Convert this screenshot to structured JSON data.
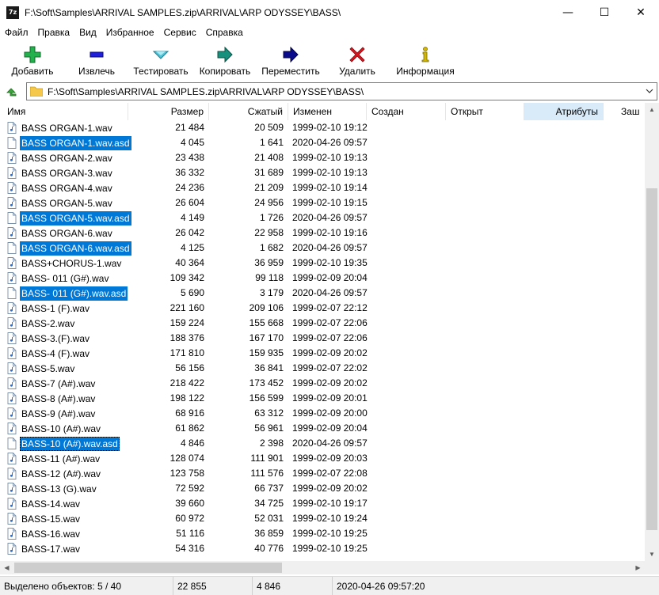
{
  "window": {
    "title": "F:\\Soft\\Samples\\ARRIVAL SAMPLES.zip\\ARRIVAL\\ARP ODYSSEY\\BASS\\",
    "app_icon": "7z",
    "controls": {
      "minimize": "—",
      "maximize": "☐",
      "close": "✕"
    }
  },
  "menu": [
    {
      "label": "Файл"
    },
    {
      "label": "Правка"
    },
    {
      "label": "Вид"
    },
    {
      "label": "Избранное"
    },
    {
      "label": "Сервис"
    },
    {
      "label": "Справка"
    }
  ],
  "toolbar": [
    {
      "label": "Добавить",
      "icon": "plus-icon",
      "color": "#22b14c"
    },
    {
      "label": "Извлечь",
      "icon": "minus-icon",
      "color": "#1f1fdc"
    },
    {
      "label": "Тестировать",
      "icon": "test-chevron-icon",
      "color": "#4fc3d8"
    },
    {
      "label": "Копировать",
      "icon": "copy-arrow-icon",
      "color": "#17907d"
    },
    {
      "label": "Переместить",
      "icon": "move-arrow-icon",
      "color": "#0a0a8c"
    },
    {
      "label": "Удалить",
      "icon": "delete-x-icon",
      "color": "#e0141e"
    },
    {
      "label": "Информация",
      "icon": "info-icon",
      "color": "#d4b800"
    }
  ],
  "address": {
    "path": "F:\\Soft\\Samples\\ARRIVAL SAMPLES.zip\\ARRIVAL\\ARP ODYSSEY\\BASS\\"
  },
  "columns": {
    "name": "Имя",
    "size": "Размер",
    "packed": "Сжатый",
    "modified": "Изменен",
    "created": "Создан",
    "accessed": "Открыт",
    "attributes": "Атрибуты",
    "encrypted": "Заш"
  },
  "files": [
    {
      "name": "BASS ORGAN-1.wav",
      "size": "21 484",
      "packed": "20 509",
      "modified": "1999-02-10 19:12",
      "selected": false
    },
    {
      "name": "BASS ORGAN-1.wav.asd",
      "size": "4 045",
      "packed": "1 641",
      "modified": "2020-04-26 09:57",
      "selected": true
    },
    {
      "name": "BASS ORGAN-2.wav",
      "size": "23 438",
      "packed": "21 408",
      "modified": "1999-02-10 19:13",
      "selected": false
    },
    {
      "name": "BASS ORGAN-3.wav",
      "size": "36 332",
      "packed": "31 689",
      "modified": "1999-02-10 19:13",
      "selected": false
    },
    {
      "name": "BASS ORGAN-4.wav",
      "size": "24 236",
      "packed": "21 209",
      "modified": "1999-02-10 19:14",
      "selected": false
    },
    {
      "name": "BASS ORGAN-5.wav",
      "size": "26 604",
      "packed": "24 956",
      "modified": "1999-02-10 19:15",
      "selected": false
    },
    {
      "name": "BASS ORGAN-5.wav.asd",
      "size": "4 149",
      "packed": "1 726",
      "modified": "2020-04-26 09:57",
      "selected": true
    },
    {
      "name": "BASS ORGAN-6.wav",
      "size": "26 042",
      "packed": "22 958",
      "modified": "1999-02-10 19:16",
      "selected": false
    },
    {
      "name": "BASS ORGAN-6.wav.asd",
      "size": "4 125",
      "packed": "1 682",
      "modified": "2020-04-26 09:57",
      "selected": true
    },
    {
      "name": "BASS+CHORUS-1.wav",
      "size": "40 364",
      "packed": "36 959",
      "modified": "1999-02-10 19:35",
      "selected": false
    },
    {
      "name": "BASS- 011 (G#).wav",
      "size": "109 342",
      "packed": "99 118",
      "modified": "1999-02-09 20:04",
      "selected": false
    },
    {
      "name": "BASS- 011 (G#).wav.asd",
      "size": "5 690",
      "packed": "3 179",
      "modified": "2020-04-26 09:57",
      "selected": true
    },
    {
      "name": "BASS-1 (F).wav",
      "size": "221 160",
      "packed": "209 106",
      "modified": "1999-02-07 22:12",
      "selected": false
    },
    {
      "name": "BASS-2.wav",
      "size": "159 224",
      "packed": "155 668",
      "modified": "1999-02-07 22:06",
      "selected": false
    },
    {
      "name": "BASS-3.(F).wav",
      "size": "188 376",
      "packed": "167 170",
      "modified": "1999-02-07 22:06",
      "selected": false
    },
    {
      "name": "BASS-4 (F).wav",
      "size": "171 810",
      "packed": "159 935",
      "modified": "1999-02-09 20:02",
      "selected": false
    },
    {
      "name": "BASS-5.wav",
      "size": "56 156",
      "packed": "36 841",
      "modified": "1999-02-07 22:02",
      "selected": false
    },
    {
      "name": "BASS-7 (A#).wav",
      "size": "218 422",
      "packed": "173 452",
      "modified": "1999-02-09 20:02",
      "selected": false
    },
    {
      "name": "BASS-8 (A#).wav",
      "size": "198 122",
      "packed": "156 599",
      "modified": "1999-02-09 20:01",
      "selected": false
    },
    {
      "name": "BASS-9 (A#).wav",
      "size": "68 916",
      "packed": "63 312",
      "modified": "1999-02-09 20:00",
      "selected": false
    },
    {
      "name": "BASS-10 (A#).wav",
      "size": "61 862",
      "packed": "56 961",
      "modified": "1999-02-09 20:04",
      "selected": false
    },
    {
      "name": "BASS-10 (A#).wav.asd",
      "size": "4 846",
      "packed": "2 398",
      "modified": "2020-04-26 09:57",
      "selected": true,
      "focused": true
    },
    {
      "name": "BASS-11 (A#).wav",
      "size": "128 074",
      "packed": "111 901",
      "modified": "1999-02-09 20:03",
      "selected": false
    },
    {
      "name": "BASS-12 (A#).wav",
      "size": "123 758",
      "packed": "111 576",
      "modified": "1999-02-07 22:08",
      "selected": false
    },
    {
      "name": "BASS-13 (G).wav",
      "size": "72 592",
      "packed": "66 737",
      "modified": "1999-02-09 20:02",
      "selected": false
    },
    {
      "name": "BASS-14.wav",
      "size": "39 660",
      "packed": "34 725",
      "modified": "1999-02-10 19:17",
      "selected": false
    },
    {
      "name": "BASS-15.wav",
      "size": "60 972",
      "packed": "52 031",
      "modified": "1999-02-10 19:24",
      "selected": false
    },
    {
      "name": "BASS-16.wav",
      "size": "51 116",
      "packed": "36 859",
      "modified": "1999-02-10 19:25",
      "selected": false
    },
    {
      "name": "BASS-17.wav",
      "size": "54 316",
      "packed": "40 776",
      "modified": "1999-02-10 19:25",
      "selected": false
    }
  ],
  "status": {
    "selected": "Выделено объектов: 5 / 40",
    "total_size": "22 855",
    "packed_size": "4 846",
    "modified": "2020-04-26 09:57:20"
  },
  "colors": {
    "selection": "#0078d7",
    "sorted_header": "#d9ebf9"
  }
}
